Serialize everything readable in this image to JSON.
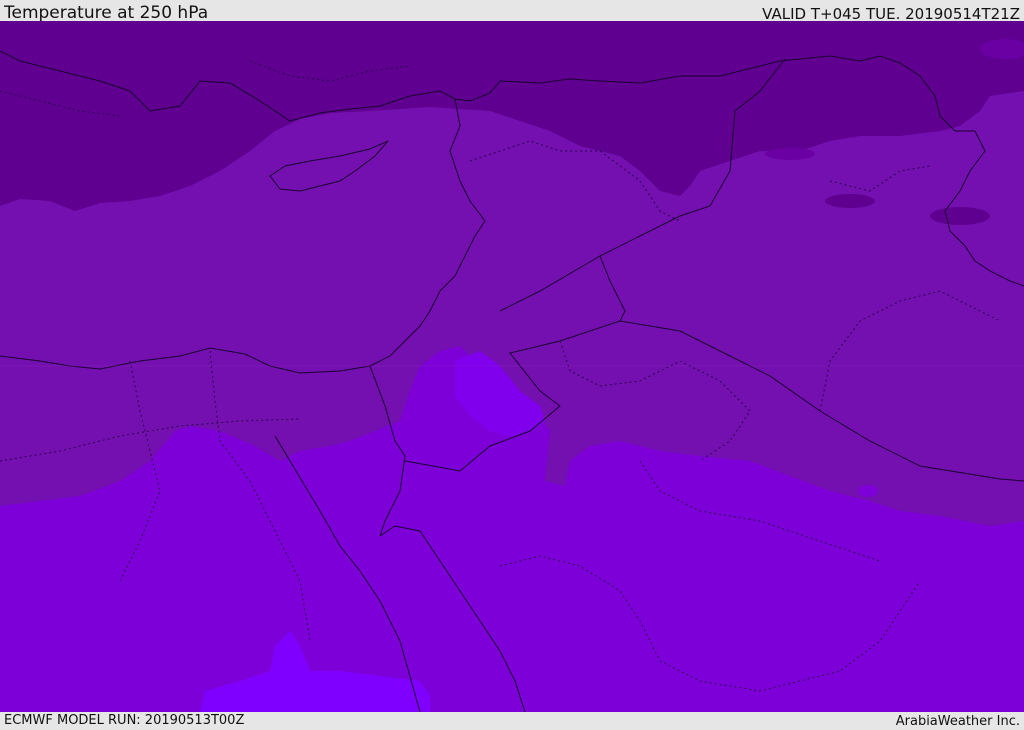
{
  "header": {
    "title": "Temperature at 250 hPa",
    "valid": "VALID T+045 TUE. 20190514T21Z"
  },
  "footer": {
    "run": "ECMWF MODEL RUN: 20190513T00Z",
    "credit": "ArabiaWeather Inc."
  },
  "map": {
    "colors": {
      "coldest": "#5f0090",
      "cold": "#7510b0",
      "mild": "#7d00d8",
      "warm": "#7f00ff",
      "border": "#1a0030"
    }
  }
}
